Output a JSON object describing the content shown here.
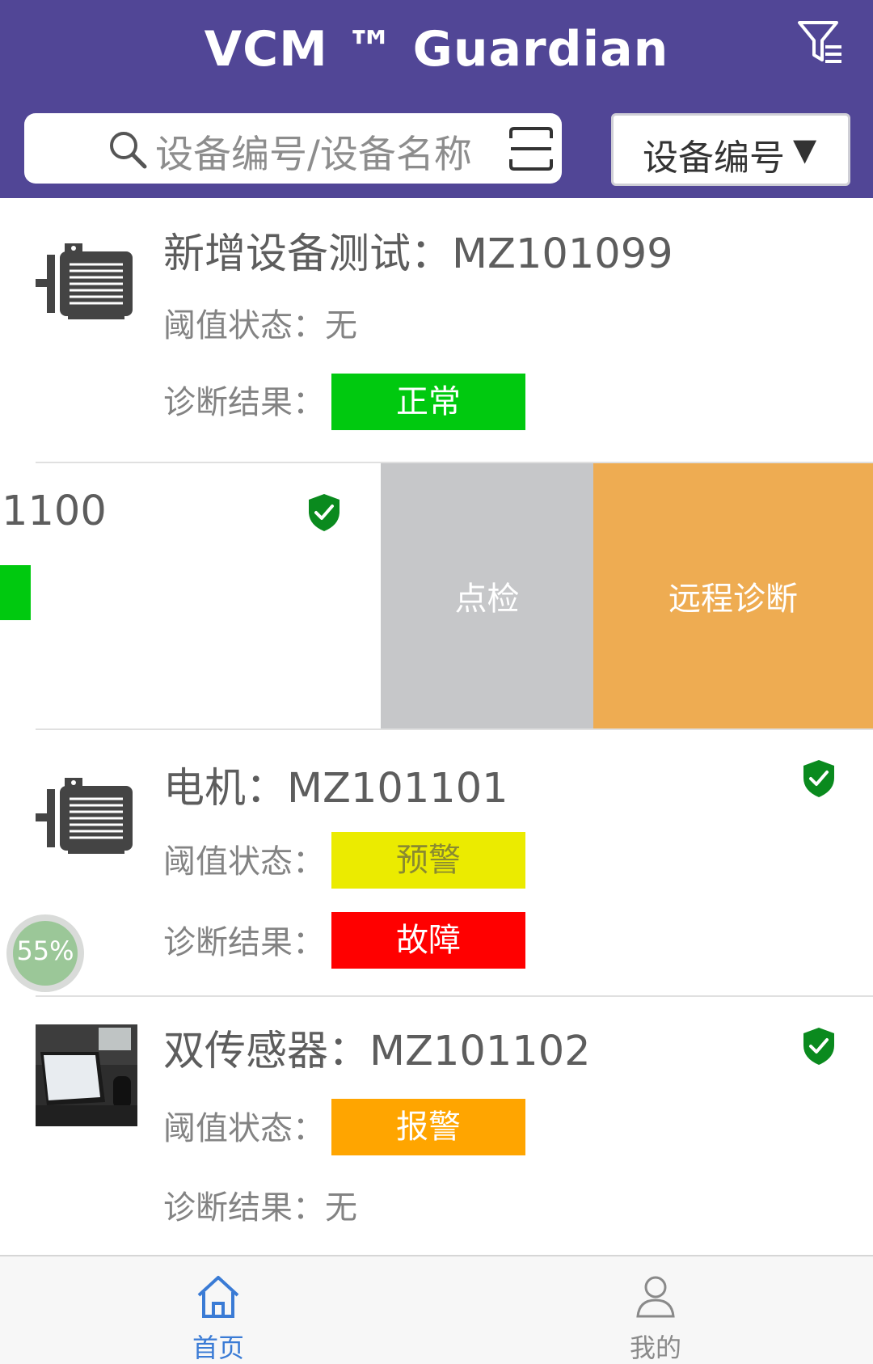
{
  "header": {
    "title": "VCM ™ Guardian",
    "search_placeholder": "设备编号/设备名称",
    "type_select": "设备编号",
    "type_select_arrow": "▼"
  },
  "colors": {
    "header_bg": "#514696",
    "normal": "#00c90f",
    "warning_yellow": "#ebeb00",
    "fault": "#ff0000",
    "alarm_orange": "#ffa500",
    "swipe_gray": "#c6c7c9",
    "swipe_orange": "#eeac52",
    "shield": "#0a8a1e",
    "nav_active": "#3a7bd5",
    "nav_inactive": "#8a8a8a"
  },
  "devices": [
    {
      "title": "新增设备测试：MZ101099",
      "threshold_label": "阈值状态：无",
      "diagnosis_label": "诊断结果：",
      "diagnosis_badge": "正常"
    },
    {
      "title_fragment": "1100",
      "action_inspect": "点检",
      "action_remote": "远程诊断"
    },
    {
      "title": "电机：MZ101101",
      "threshold_label": "阈值状态：",
      "threshold_badge": "预警",
      "diagnosis_label": "诊断结果：",
      "diagnosis_badge": "故障"
    },
    {
      "title": "双传感器：MZ101102",
      "threshold_label": "阈值状态：",
      "threshold_badge": "报警",
      "diagnosis_label": "诊断结果：无"
    }
  ],
  "progress_indicator": "55%",
  "bottom_nav": {
    "home": "首页",
    "mine": "我的"
  }
}
